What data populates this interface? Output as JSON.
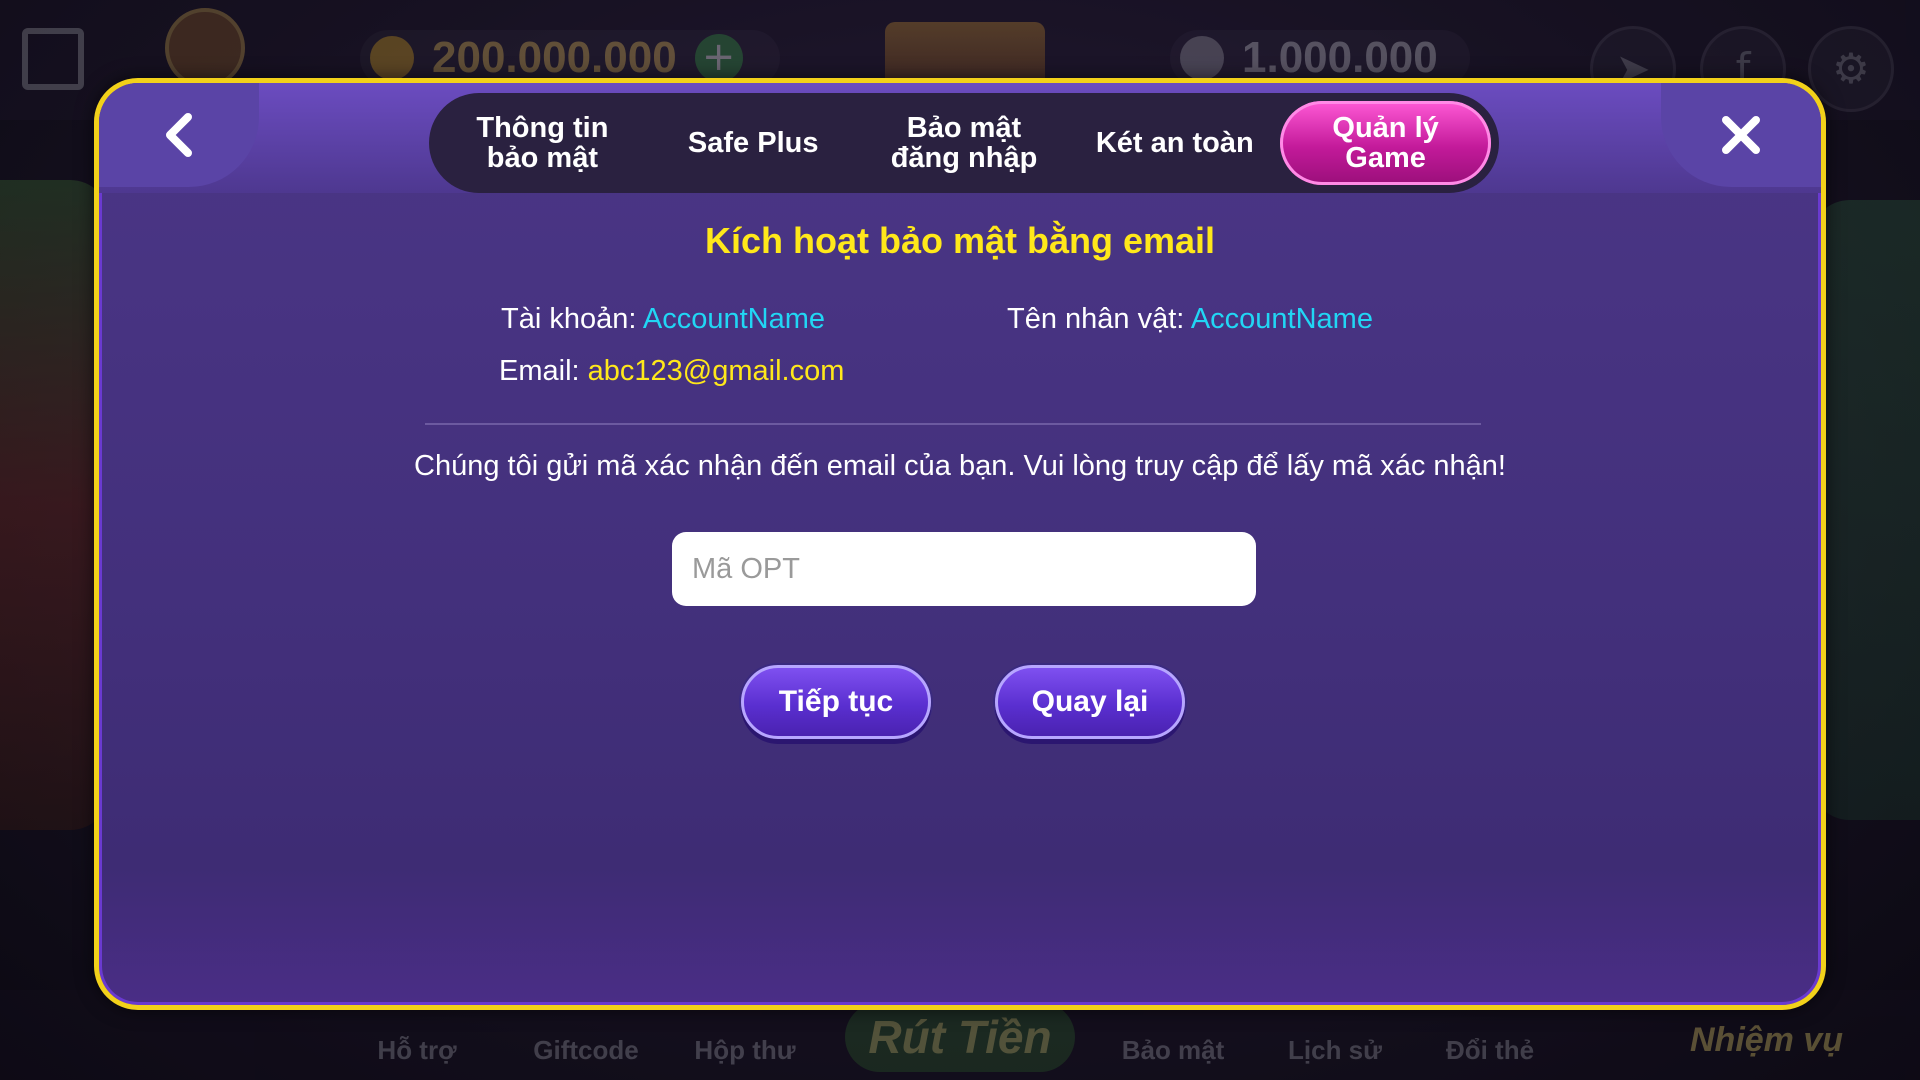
{
  "background": {
    "balance_gold": "200.000.000",
    "balance_silver": "1.000.000",
    "plus_symbol": "+",
    "settings_symbol": "⚙",
    "bottom_nav": [
      "Hỗ trợ",
      "Giftcode",
      "Hộp thư",
      "Bảo mật",
      "Lịch sử",
      "Đổi thẻ"
    ],
    "rut_tien": "Rút Tiền",
    "nhiem_vu": "Nhiệm vụ"
  },
  "modal": {
    "tabs": [
      {
        "label": "Thông tin\nbảo mật",
        "active": false
      },
      {
        "label": "Safe Plus",
        "active": false
      },
      {
        "label": "Bảo mật\nđăng nhập",
        "active": false
      },
      {
        "label": "Két an toàn",
        "active": false
      },
      {
        "label": "Quản lý\nGame",
        "active": true
      }
    ],
    "heading": "Kích hoạt bảo mật bằng email",
    "account_label": "Tài khoản: ",
    "account_value": "AccountName",
    "character_label": "Tên nhân vật: ",
    "character_value": "AccountName",
    "email_label": "Email: ",
    "email_value": "abc123@gmail.com",
    "notice": "Chúng tôi gửi mã xác nhận đến email của bạn. Vui lòng truy cập để lấy mã xác nhận!",
    "otp_placeholder": "Mã OPT",
    "otp_value": "",
    "continue_label": "Tiếp tục",
    "back_label": "Quay lại"
  },
  "colors": {
    "border": "#f2d11a",
    "heading": "#ffe81a",
    "value_cyan": "#21d6f4",
    "active_tab": "#c31a9a",
    "panel": "#43307c"
  }
}
